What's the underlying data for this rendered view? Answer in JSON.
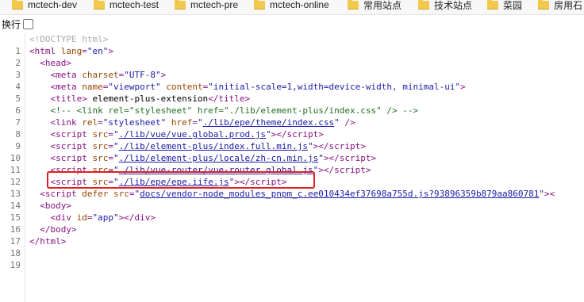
{
  "bookmarks": [
    {
      "label": "mctech-dev"
    },
    {
      "label": "mctech-test"
    },
    {
      "label": "mctech-pre"
    },
    {
      "label": "mctech-online"
    },
    {
      "label": "常用站点"
    },
    {
      "label": "技术站点"
    },
    {
      "label": "菜园"
    },
    {
      "label": "房用石"
    }
  ],
  "wrap_toggle": {
    "label": "换行",
    "checked": false
  },
  "source_lines": [
    {
      "n": "1"
    },
    {
      "n": "2"
    },
    {
      "n": "3"
    },
    {
      "n": "4"
    },
    {
      "n": "5"
    },
    {
      "n": "6"
    },
    {
      "n": "7"
    },
    {
      "n": "8"
    },
    {
      "n": "9"
    },
    {
      "n": "10"
    },
    {
      "n": "11"
    },
    {
      "n": "12"
    },
    {
      "n": "13"
    },
    {
      "n": "14"
    },
    {
      "n": "15"
    },
    {
      "n": "16"
    },
    {
      "n": "17"
    },
    {
      "n": "18"
    },
    {
      "n": "19"
    }
  ],
  "code": {
    "doctype": "<!DOCTYPE html>",
    "html_lang": "\"en\"",
    "meta_charset": "\"UTF-8\"",
    "meta_name": "\"viewport\"",
    "meta_content": "\"initial-scale=1,width=device-width, minimal-ui\"",
    "title_text": "element-plus-extension",
    "comment": "<!-- <link rel=\"stylesheet\" href=\"./lib/element-plus/index.css\" /> -->",
    "link_rel": "\"stylesheet\"",
    "link_href": "./lib/epe/theme/index.css",
    "script_vue": "./lib/vue/vue.global.prod.js",
    "script_ep": "./lib/element-plus/index.full.min.js",
    "script_locale": "./lib/element-plus/locale/zh-cn.min.js",
    "script_router": "./lib/vue-router/vue-router.global.js",
    "script_epe": "./lib/epe/epe.iife.js",
    "script_vendor": "docs/vendor-node_modules_pnpm_c.ee010434ef37698a755d.js?93896359b879aa860781",
    "div_id": "\"app\""
  },
  "highlight_color": "#e02020"
}
